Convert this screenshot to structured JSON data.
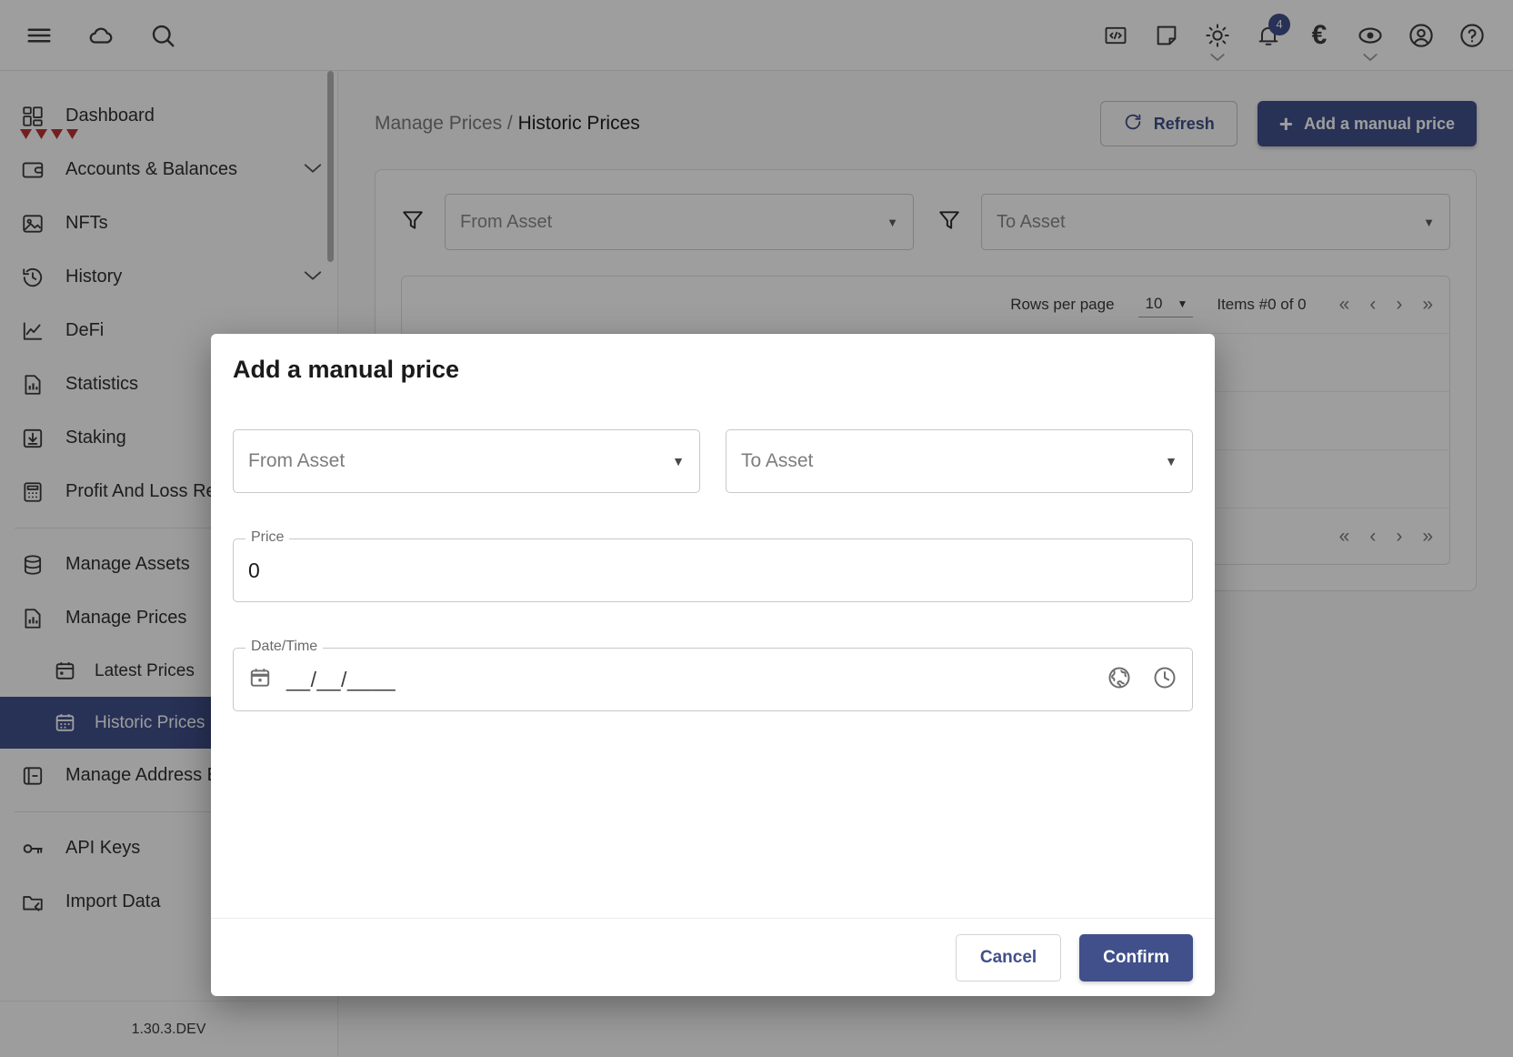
{
  "topbar": {
    "left_icons": [
      {
        "name": "menu-icon",
        "label": "Menu"
      },
      {
        "name": "cloud-icon",
        "label": "Cloud sync"
      },
      {
        "name": "search-icon",
        "label": "Search"
      }
    ],
    "right_icons": [
      {
        "name": "code-icon",
        "label": "Developer"
      },
      {
        "name": "note-icon",
        "label": "Notes"
      },
      {
        "name": "theme-sun-icon",
        "label": "Theme"
      },
      {
        "name": "notifications-bell-icon",
        "label": "Notifications"
      },
      {
        "name": "currency-euro-icon",
        "label": "Currency"
      },
      {
        "name": "privacy-eye-icon",
        "label": "Privacy mode"
      },
      {
        "name": "account-circle-icon",
        "label": "Account"
      },
      {
        "name": "help-icon",
        "label": "Help"
      }
    ],
    "notification_count": "4",
    "currency_symbol": "€"
  },
  "sidebar": {
    "items": [
      {
        "label": "Dashboard",
        "icon": "dashboard-icon",
        "expandable": false,
        "active": false
      },
      {
        "label": "Accounts & Balances",
        "icon": "wallet-icon",
        "expandable": true,
        "active": false
      },
      {
        "label": "NFTs",
        "icon": "image-icon",
        "expandable": false,
        "active": false
      },
      {
        "label": "History",
        "icon": "history-clock-icon",
        "expandable": true,
        "active": false
      },
      {
        "label": "DeFi",
        "icon": "chart-line-icon",
        "expandable": false,
        "active": false
      },
      {
        "label": "Statistics",
        "icon": "bar-chart-icon",
        "expandable": false,
        "active": false
      },
      {
        "label": "Staking",
        "icon": "staking-box-icon",
        "expandable": false,
        "active": false
      },
      {
        "label": "Profit And Loss Report",
        "icon": "calculator-icon",
        "expandable": false,
        "active": false
      }
    ],
    "group2": [
      {
        "label": "Manage Assets",
        "icon": "database-icon",
        "active": false
      },
      {
        "label": "Manage Prices",
        "icon": "price-chart-icon",
        "active": false
      }
    ],
    "sub_items": [
      {
        "label": "Latest Prices",
        "icon": "calendar-icon",
        "active": false
      },
      {
        "label": "Historic Prices",
        "icon": "calendar-dots-icon",
        "active": true
      }
    ],
    "group3": [
      {
        "label": "Manage Address Book",
        "icon": "address-book-icon",
        "active": false
      }
    ],
    "group4": [
      {
        "label": "API Keys",
        "icon": "key-icon",
        "active": false
      },
      {
        "label": "Import Data",
        "icon": "folder-import-icon",
        "active": false
      }
    ],
    "version": "1.30.3.DEV"
  },
  "main": {
    "breadcrumb_parent": "Manage Prices",
    "breadcrumb_separator": " / ",
    "breadcrumb_current": "Historic Prices",
    "refresh_label": "Refresh",
    "add_price_label": "Add a manual price",
    "add_price_plus": "+",
    "filters": {
      "from_asset_placeholder": "From Asset",
      "to_asset_placeholder": "To Asset"
    },
    "pager": {
      "rows_per_page_label": "Rows per page",
      "rows_per_page_value": "10",
      "items_label": "Items #0 of 0",
      "first": "«",
      "prev": "‹",
      "next": "›",
      "last": "»"
    }
  },
  "modal": {
    "title": "Add a manual price",
    "from_asset_placeholder": "From Asset",
    "to_asset_placeholder": "To Asset",
    "price_label": "Price",
    "price_value": "0",
    "datetime_label": "Date/Time",
    "datetime_mask": "__/__/____",
    "cancel_label": "Cancel",
    "confirm_label": "Confirm"
  },
  "colors": {
    "accent": "#41508b",
    "topbar_bg": "#ffffff",
    "active_item_bg": "#41508b",
    "badge_bg": "#41508b"
  }
}
